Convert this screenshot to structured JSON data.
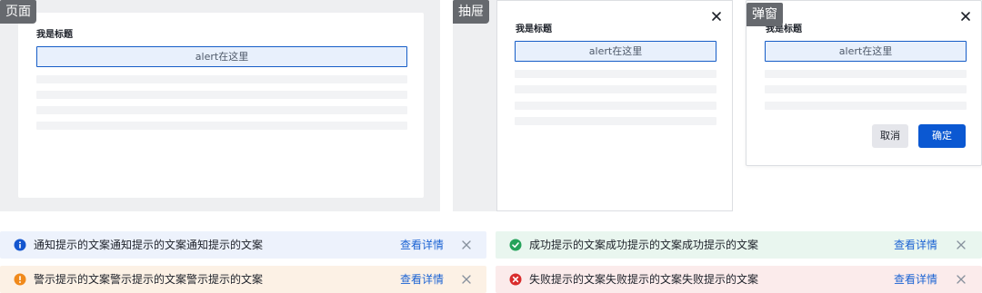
{
  "panels": {
    "page": {
      "tag": "页面",
      "title": "我是标题",
      "alert": "alert在这里"
    },
    "drawer": {
      "tag": "抽屉",
      "title": "我是标题",
      "alert": "alert在这里",
      "close_icon": "close-icon"
    },
    "modal": {
      "tag": "弹窗",
      "title": "我是标题",
      "alert": "alert在这里",
      "close_icon": "close-icon",
      "cancel_label": "取消",
      "ok_label": "确定"
    }
  },
  "notifications": [
    {
      "type": "info",
      "icon": "info-icon",
      "color": "#1456cf",
      "background": "#edf2fc",
      "message": "通知提示的文案通知提示的文案通知提示的文案",
      "link": "查看详情"
    },
    {
      "type": "success",
      "icon": "check-circle-icon",
      "color": "#25a25a",
      "background": "#e9f6ef",
      "message": "成功提示的文案成功提示的文案成功提示的文案",
      "link": "查看详情"
    },
    {
      "type": "warning",
      "icon": "warning-icon",
      "color": "#f08a1c",
      "background": "#fcf1e5",
      "message": "警示提示的文案警示提示的文案警示提示的文案",
      "link": "查看详情"
    },
    {
      "type": "error",
      "icon": "error-icon",
      "color": "#d92c2c",
      "background": "#fbebeb",
      "message": "失败提示的文案失败提示的文案失败提示的文案",
      "link": "查看详情"
    }
  ],
  "colors": {
    "alert_border": "#165dc7",
    "alert_fill": "#e8f0fc",
    "primary_button": "#0b58d2",
    "link": "#1b63d3",
    "tag_background": "#66696e"
  }
}
